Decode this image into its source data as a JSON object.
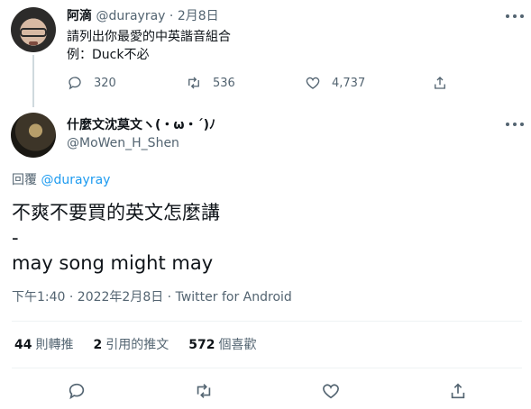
{
  "parent_tweet": {
    "name": "阿滴",
    "handle": "@durayray",
    "separator": "·",
    "date": "2月8日",
    "lines": [
      "請列出你最愛的中英諧音組合",
      "例：Duck不必"
    ],
    "replies": "320",
    "retweets": "536",
    "likes": "4,737"
  },
  "main_tweet": {
    "name": "什麼文沈莫文ヽ(・ω・´)ﾉ",
    "handle": "@MoWen_H_Shen",
    "reply_prefix": "回覆",
    "reply_to": "@durayray",
    "lines": [
      "不爽不要買的英文怎麼講",
      "-",
      "may song might may"
    ],
    "meta": "下午1:40 · 2022年2月8日 · Twitter for Android",
    "stats": {
      "retweets_count": "44",
      "retweets_label": "則轉推",
      "quotes_count": "2",
      "quotes_label": "引用的推文",
      "likes_count": "572",
      "likes_label": "個喜歡"
    }
  },
  "icons": {
    "reply": "reply-bubble-icon",
    "retweet": "retweet-icon",
    "like": "heart-icon",
    "share": "share-icon",
    "more": "more-dots-icon"
  },
  "colors": {
    "text": "#0f1419",
    "muted": "#536471",
    "link": "#1d9bf0",
    "divider": "#eff3f4"
  }
}
